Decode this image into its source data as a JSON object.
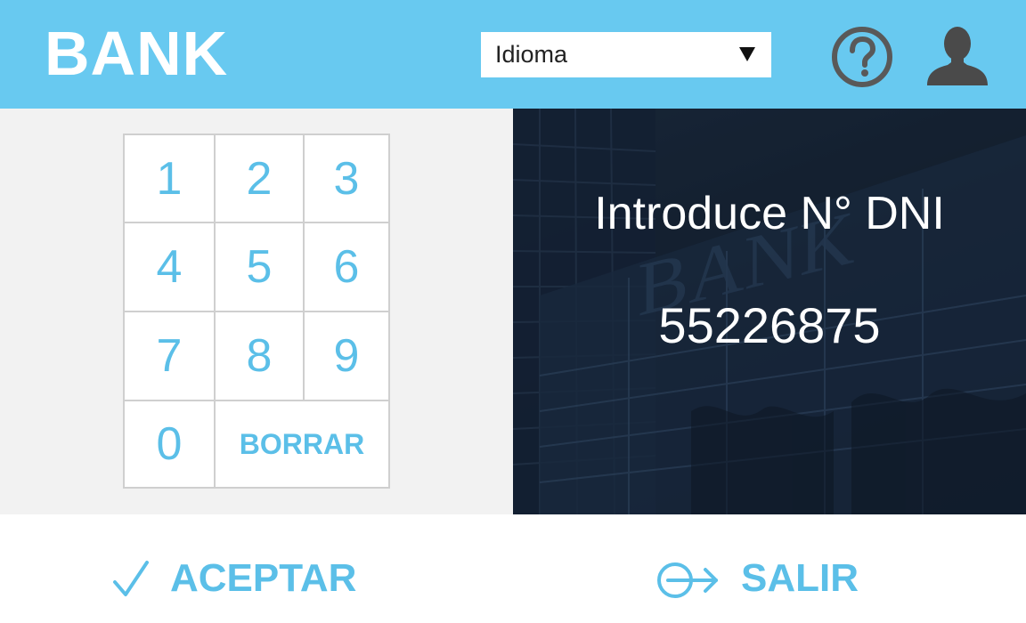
{
  "header": {
    "brand": "BANK",
    "language_select": {
      "selected": "Idioma"
    },
    "help_icon": "help-circle-icon",
    "user_icon": "user-avatar-icon"
  },
  "keypad": {
    "keys": [
      "1",
      "2",
      "3",
      "4",
      "5",
      "6",
      "7",
      "8",
      "9",
      "0"
    ],
    "delete_label": "BORRAR"
  },
  "display": {
    "background_watermark": "BANK",
    "prompt": "Introduce N° DNI",
    "value": "55226875"
  },
  "footer": {
    "accept_label": "ACEPTAR",
    "exit_label": "SALIR"
  },
  "colors": {
    "header_bg": "#68c9f0",
    "accent": "#5bbfe8",
    "panel_bg": "#f2f2f2",
    "dark_panel": "#13202f"
  }
}
